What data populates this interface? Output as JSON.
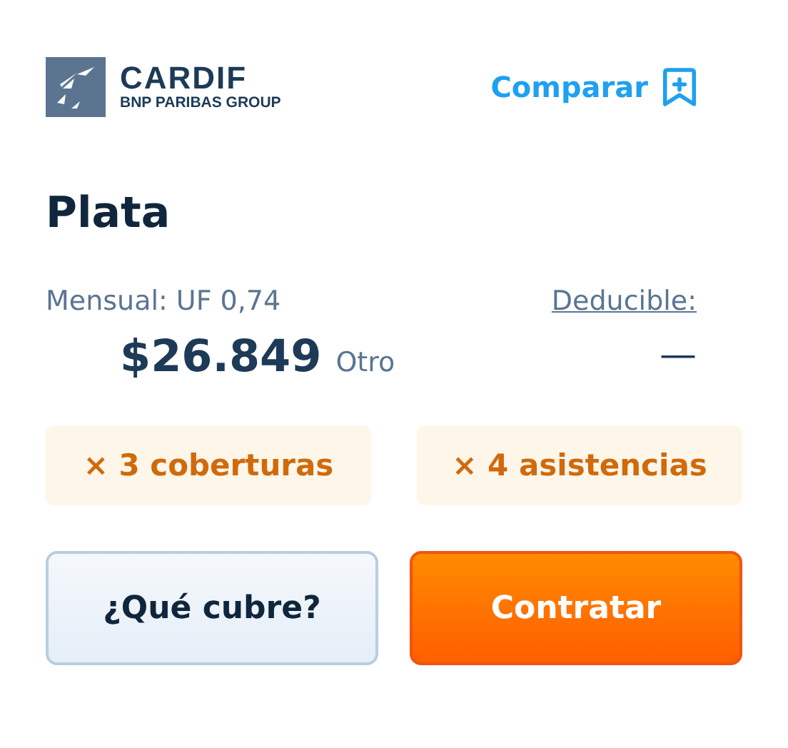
{
  "header": {
    "logo": {
      "name": "CARDIF",
      "tagline": "BNP PARIBAS GROUP"
    },
    "compare_link": "Comparar"
  },
  "plan": {
    "title": "Plata",
    "monthly_label": "Mensual: UF 0,74",
    "price": "$26.849",
    "price_note": "Otro",
    "deductible_label": "Deducible:",
    "deductible_value": "—"
  },
  "chips": [
    "× 3 coberturas",
    "× 4 asistencias"
  ],
  "buttons": [
    {
      "kind": "secondary",
      "label": "¿Qué cubre?"
    },
    {
      "kind": "primary",
      "label": "Contratar"
    }
  ]
}
